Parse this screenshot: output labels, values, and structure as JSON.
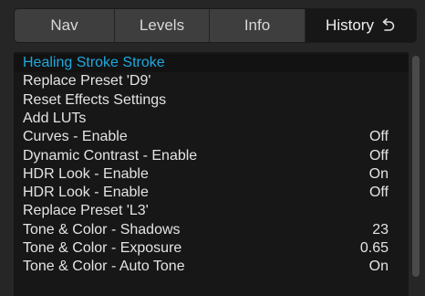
{
  "tabs": [
    {
      "label": "Nav",
      "active": false
    },
    {
      "label": "Levels",
      "active": false
    },
    {
      "label": "Info",
      "active": false
    },
    {
      "label": "History",
      "active": true,
      "icon": "undo-icon"
    }
  ],
  "history": {
    "selected_color": "#1fa9df",
    "items": [
      {
        "label": "Healing Stroke Stroke",
        "value": "",
        "selected": true
      },
      {
        "label": "Replace Preset 'D9'",
        "value": ""
      },
      {
        "label": "Reset Effects Settings",
        "value": ""
      },
      {
        "label": "Add LUTs",
        "value": ""
      },
      {
        "label": "Curves - Enable",
        "value": "Off"
      },
      {
        "label": "Dynamic Contrast - Enable",
        "value": "Off"
      },
      {
        "label": "HDR Look - Enable",
        "value": "On"
      },
      {
        "label": "HDR Look - Enable",
        "value": "Off"
      },
      {
        "label": "Replace Preset 'L3'",
        "value": ""
      },
      {
        "label": "Tone & Color - Shadows",
        "value": "23"
      },
      {
        "label": "Tone & Color - Exposure",
        "value": "0.65"
      },
      {
        "label": "Tone & Color - Auto Tone",
        "value": "On"
      }
    ]
  }
}
